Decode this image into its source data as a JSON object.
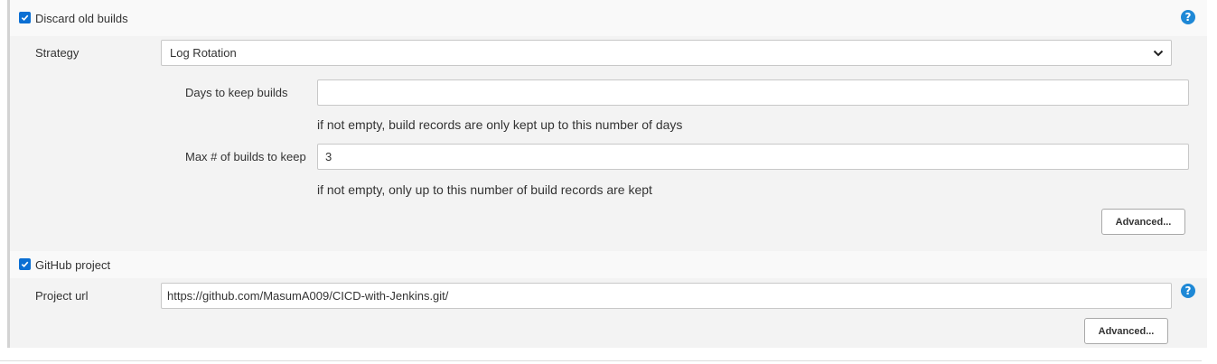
{
  "discard": {
    "label": "Discard old builds",
    "checked": true,
    "help_icon": "question-mark-icon",
    "strategy": {
      "label": "Strategy",
      "selected": "Log Rotation"
    },
    "days_to_keep": {
      "label": "Days to keep builds",
      "value": "",
      "hint": "if not empty, build records are only kept up to this number of days"
    },
    "max_builds": {
      "label": "Max # of builds to keep",
      "value": "3",
      "hint": "if not empty, only up to this number of build records are kept"
    },
    "advanced_label": "Advanced..."
  },
  "github": {
    "label": "GitHub project",
    "checked": true,
    "project_url": {
      "label": "Project url",
      "value": "https://github.com/MasumA009/CICD-with-Jenkins.git/"
    },
    "help_icon": "question-mark-icon",
    "advanced_label": "Advanced..."
  },
  "colors": {
    "accent": "#0b6fd3",
    "help_icon": "#1e88d6",
    "panel": "#f3f3f3"
  }
}
